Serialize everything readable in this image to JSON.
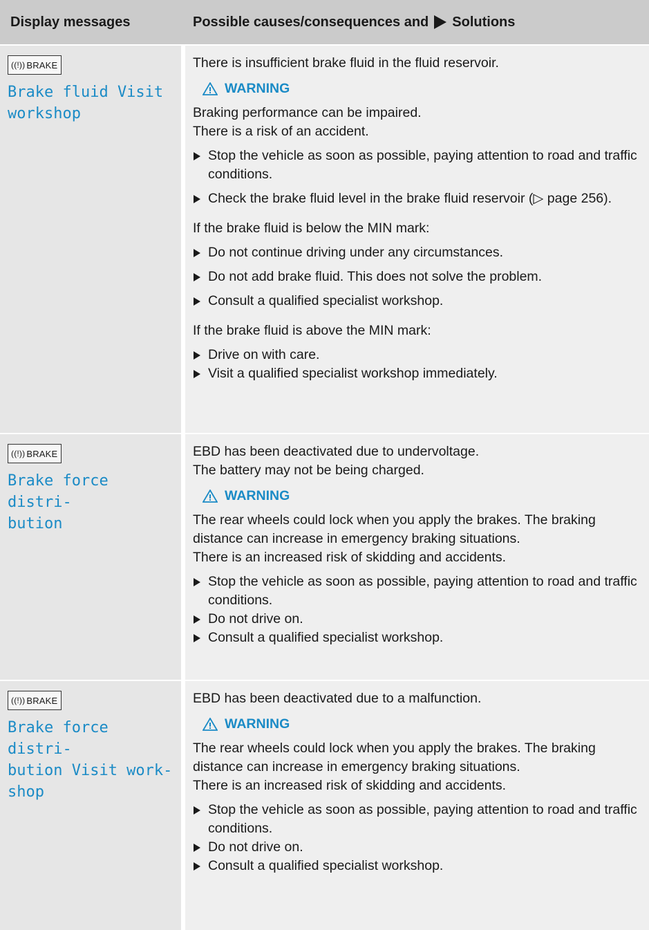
{
  "header": {
    "col1": "Display messages",
    "col2_prefix": "Possible causes/consequences and",
    "col2_suffix": "Solutions"
  },
  "icon_label": "BRAKE",
  "rows": [
    {
      "message": "Brake fluid Visit\nworkshop",
      "intro": "There is insufficient brake fluid in the fluid reservoir.",
      "warning": "WARNING",
      "w1": "Braking performance can be impaired.",
      "w2": "There is a risk of an accident.",
      "b1": "Stop the vehicle as soon as possible, paying attention to road and traffic conditions.",
      "b2": "Check the brake fluid level in the brake fluid reservoir (▷ page 256).",
      "cond1": "If the brake fluid is below the MIN mark:",
      "b3": "Do not continue driving under any circumstances.",
      "b4": "Do not add brake fluid. This does not solve the problem.",
      "b5": "Consult a qualified specialist workshop.",
      "cond2": "If the brake fluid is above the MIN mark:",
      "b6": "Drive on with care.",
      "b7": "Visit a qualified specialist workshop immediately."
    },
    {
      "message": "Brake force distri-\nbution",
      "intro1": "EBD has been deactivated due to undervoltage.",
      "intro2": "The battery may not be being charged.",
      "warning": "WARNING",
      "w1": "The rear wheels could lock when you apply the brakes. The braking distance can increase in emergency braking situations.",
      "w2": "There is an increased risk of skidding and accidents.",
      "b1": "Stop the vehicle as soon as possible, paying attention to road and traffic conditions.",
      "b2": "Do not drive on.",
      "b3": "Consult a qualified specialist workshop."
    },
    {
      "message": "Brake force distri-\nbution Visit work-\nshop",
      "intro": "EBD has been deactivated due to a malfunction.",
      "warning": "WARNING",
      "w1": "The rear wheels could lock when you apply the brakes. The braking distance can increase in emergency braking situations.",
      "w2": "There is an increased risk of skidding and accidents.",
      "b1": "Stop the vehicle as soon as possible, paying attention to road and traffic conditions.",
      "b2": "Do not drive on.",
      "b3": "Consult a qualified specialist workshop."
    }
  ],
  "colors": {
    "accent": "#1b8bc6",
    "header_bg": "#cbcbcb",
    "left_bg": "#e6e6e6",
    "right_bg": "#efefef"
  }
}
